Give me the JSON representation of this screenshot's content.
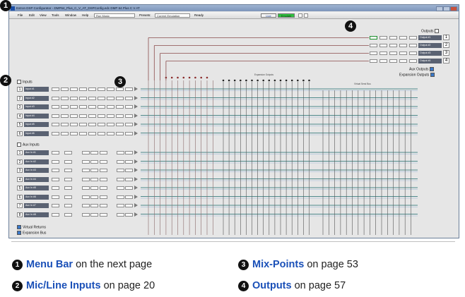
{
  "window": {
    "title": "Extron DSP Configurator - DMP64_Plus_C_V_AT_DSPConfig.edc  DMP 64 Plus C V AT"
  },
  "menubar": {
    "items": [
      "File",
      "Edit",
      "View",
      "Tools",
      "Window",
      "Help"
    ],
    "zone_combo": "Run Music",
    "presets_label": "Presets:",
    "presets_value": "Current Emulation",
    "status": "Ready",
    "live_label": "Live",
    "emulate_label": "Emulate"
  },
  "inputs": {
    "header": "Inputs",
    "items": [
      "Input #1",
      "Input #2",
      "Input #3",
      "Input #4",
      "Input #5",
      "Input #6"
    ]
  },
  "aux_inputs": {
    "header": "Aux Inputs",
    "items": [
      "Aux In #1",
      "Aux In #2",
      "Aux In #3",
      "Aux In #4",
      "Aux In #5",
      "Aux In #6",
      "Aux In #7",
      "Aux In #8"
    ]
  },
  "virtual_returns_label": "Virtual Returns",
  "expansion_bus_label": "Expansion Bus",
  "outputs": {
    "header": "Outputs",
    "items": [
      "Output #1",
      "Output #2",
      "Output #3",
      "Output #4"
    ],
    "numbers": [
      "1",
      "2",
      "3",
      "4"
    ]
  },
  "aux_outputs_label": "Aux Outputs",
  "expansion_outputs_label": "Expansion Outputs",
  "expansion_outputs_caption": "Expansion Outputs",
  "virtual_send_bus_caption": "Virtual Send Bus",
  "callouts": [
    "1",
    "2",
    "3",
    "4"
  ],
  "legend": [
    {
      "num": "1",
      "link": "Menu Bar",
      "rest": "on the next page"
    },
    {
      "num": "2",
      "link": "Mic/Line Inputs",
      "rest": "on page 20"
    },
    {
      "num": "3",
      "link": "Mix-Points",
      "rest": "on page 53"
    },
    {
      "num": "4",
      "link": "Outputs",
      "rest": "on page 57"
    }
  ]
}
